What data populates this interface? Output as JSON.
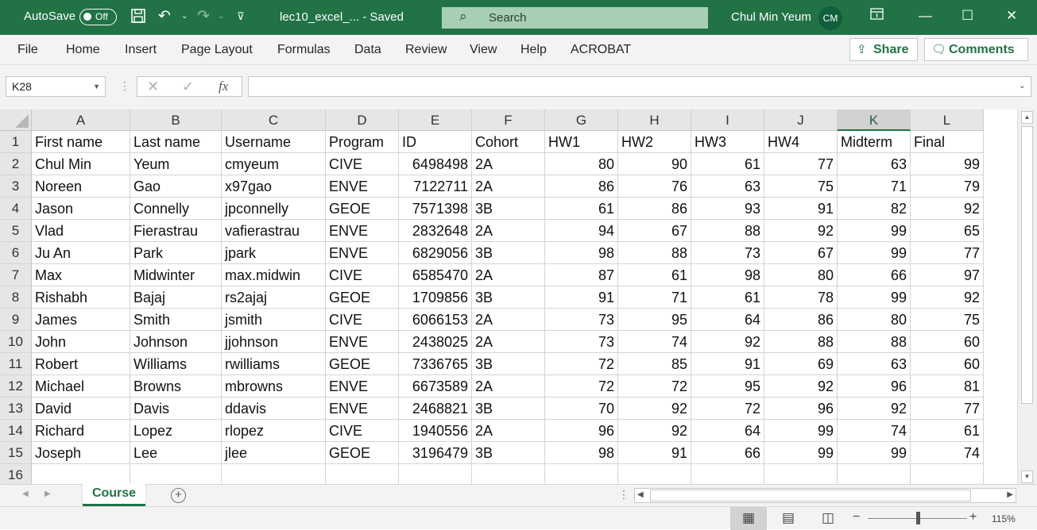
{
  "titlebar": {
    "autosave_label": "AutoSave",
    "toggle_label": "Off",
    "document_title": "lec10_excel_...  -  Saved",
    "search_placeholder": "Search",
    "user_name": "Chul Min Yeum",
    "user_initials": "CM",
    "icons": [
      "save-icon",
      "undo-icon",
      "redo-icon",
      "customize-qat-icon"
    ]
  },
  "menu": {
    "items": [
      "File",
      "Home",
      "Insert",
      "Page Layout",
      "Formulas",
      "Data",
      "Review",
      "View",
      "Help",
      "ACROBAT"
    ],
    "share_label": "Share",
    "comments_label": "Comments"
  },
  "formula_bar": {
    "name_box": "K28",
    "formula": ""
  },
  "grid": {
    "columns": [
      "A",
      "B",
      "C",
      "D",
      "E",
      "F",
      "G",
      "H",
      "I",
      "J",
      "K",
      "L"
    ],
    "selected_column": "K",
    "row_numbers": [
      "1",
      "2",
      "3",
      "4",
      "5",
      "6",
      "7",
      "8",
      "9",
      "10",
      "11",
      "12",
      "13",
      "14",
      "15",
      "16"
    ],
    "rows": [
      [
        "First name",
        "Last name",
        "Username",
        "Program",
        "ID",
        "Cohort",
        "HW1",
        "HW2",
        "HW3",
        "HW4",
        "Midterm",
        "Final"
      ],
      [
        "Chul Min",
        "Yeum",
        "cmyeum",
        "CIVE",
        "6498498",
        "2A",
        "80",
        "90",
        "61",
        "77",
        "63",
        "99"
      ],
      [
        "Noreen",
        "Gao",
        "x97gao",
        "ENVE",
        "7122711",
        "2A",
        "86",
        "76",
        "63",
        "75",
        "71",
        "79"
      ],
      [
        "Jason",
        "Connelly",
        "jpconnelly",
        "GEOE",
        "7571398",
        "3B",
        "61",
        "86",
        "93",
        "91",
        "82",
        "92"
      ],
      [
        "Vlad",
        "Fierastrau",
        "vafierastrau",
        "ENVE",
        "2832648",
        "2A",
        "94",
        "67",
        "88",
        "92",
        "99",
        "65"
      ],
      [
        "Ju An",
        "Park",
        "jpark",
        "ENVE",
        "6829056",
        "3B",
        "98",
        "88",
        "73",
        "67",
        "99",
        "77"
      ],
      [
        "Max",
        "Midwinter",
        "max.midwin",
        "CIVE",
        "6585470",
        "2A",
        "87",
        "61",
        "98",
        "80",
        "66",
        "97"
      ],
      [
        "Rishabh",
        "Bajaj",
        "rs2ajaj",
        "GEOE",
        "1709856",
        "3B",
        "91",
        "71",
        "61",
        "78",
        "99",
        "92"
      ],
      [
        "James",
        "Smith",
        "jsmith",
        "CIVE",
        "6066153",
        "2A",
        "73",
        "95",
        "64",
        "86",
        "80",
        "75"
      ],
      [
        "John",
        "Johnson",
        "jjohnson",
        "ENVE",
        "2438025",
        "2A",
        "73",
        "74",
        "92",
        "88",
        "88",
        "60"
      ],
      [
        "Robert",
        "Williams",
        "rwilliams",
        "GEOE",
        "7336765",
        "3B",
        "72",
        "85",
        "91",
        "69",
        "63",
        "60"
      ],
      [
        "Michael",
        "Browns",
        "mbrowns",
        "ENVE",
        "6673589",
        "2A",
        "72",
        "72",
        "95",
        "92",
        "96",
        "81"
      ],
      [
        "David",
        "Davis",
        "ddavis",
        "ENVE",
        "2468821",
        "3B",
        "70",
        "92",
        "72",
        "96",
        "92",
        "77"
      ],
      [
        "Richard",
        "Lopez",
        "rlopez",
        "CIVE",
        "1940556",
        "2A",
        "96",
        "92",
        "64",
        "99",
        "74",
        "61"
      ],
      [
        "Joseph",
        "Lee",
        "jlee",
        "GEOE",
        "3196479",
        "3B",
        "98",
        "91",
        "66",
        "99",
        "99",
        "74"
      ],
      [
        "",
        "",
        "",
        "",
        "",
        "",
        "",
        "",
        "",
        "",
        "",
        ""
      ]
    ]
  },
  "sheets": {
    "active_tab": "Course"
  },
  "status": {
    "zoom_level": "115%",
    "zoom_fraction": 0.5
  },
  "colors": {
    "accent": "#217346",
    "search_bg": "#a7cfb3"
  }
}
